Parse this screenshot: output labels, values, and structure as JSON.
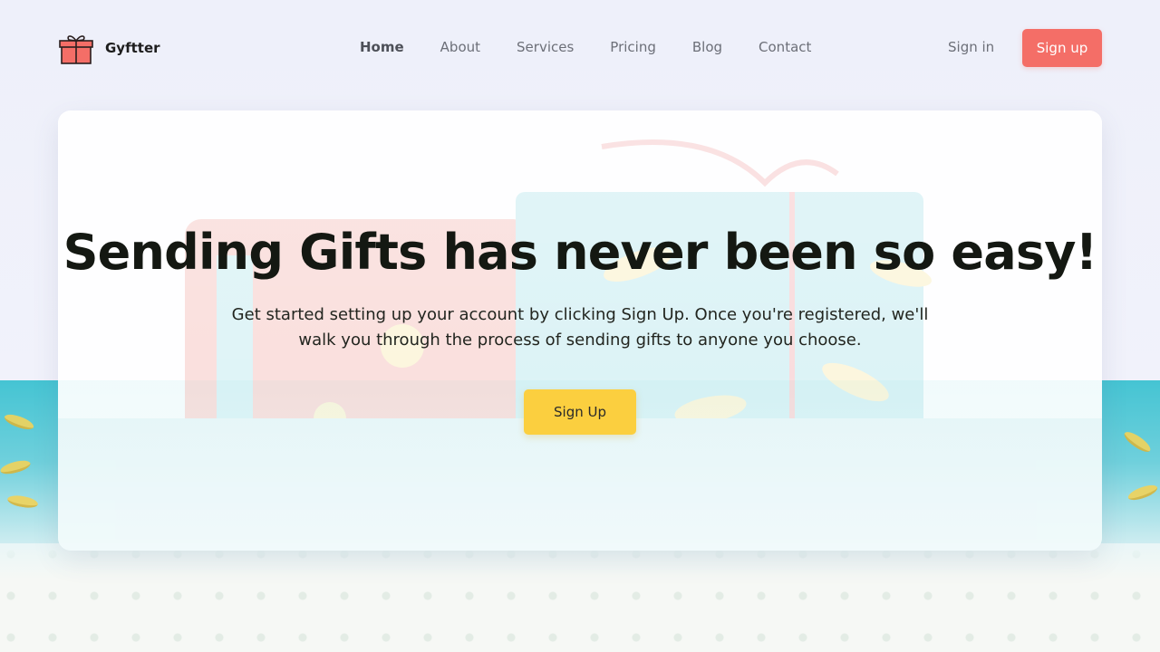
{
  "brand": {
    "name": "Gyftter",
    "logo_icon": "gift-icon"
  },
  "nav": {
    "links": [
      {
        "label": "Home",
        "active": true
      },
      {
        "label": "About",
        "active": false
      },
      {
        "label": "Services",
        "active": false
      },
      {
        "label": "Pricing",
        "active": false
      },
      {
        "label": "Blog",
        "active": false
      },
      {
        "label": "Contact",
        "active": false
      }
    ],
    "sign_in": "Sign in",
    "sign_up": "Sign up"
  },
  "hero": {
    "title": "Sending Gifts has never been so easy!",
    "subtitle": "Get started setting up your account by clicking Sign Up. Once you're registered, we'll walk you through the process of sending gifts to anyone you choose.",
    "cta": "Sign Up"
  },
  "colors": {
    "accent_red": "#f46e67",
    "accent_yellow": "#fbcf3f",
    "background": "#f1f2fa",
    "teal": "#45c4d3"
  }
}
